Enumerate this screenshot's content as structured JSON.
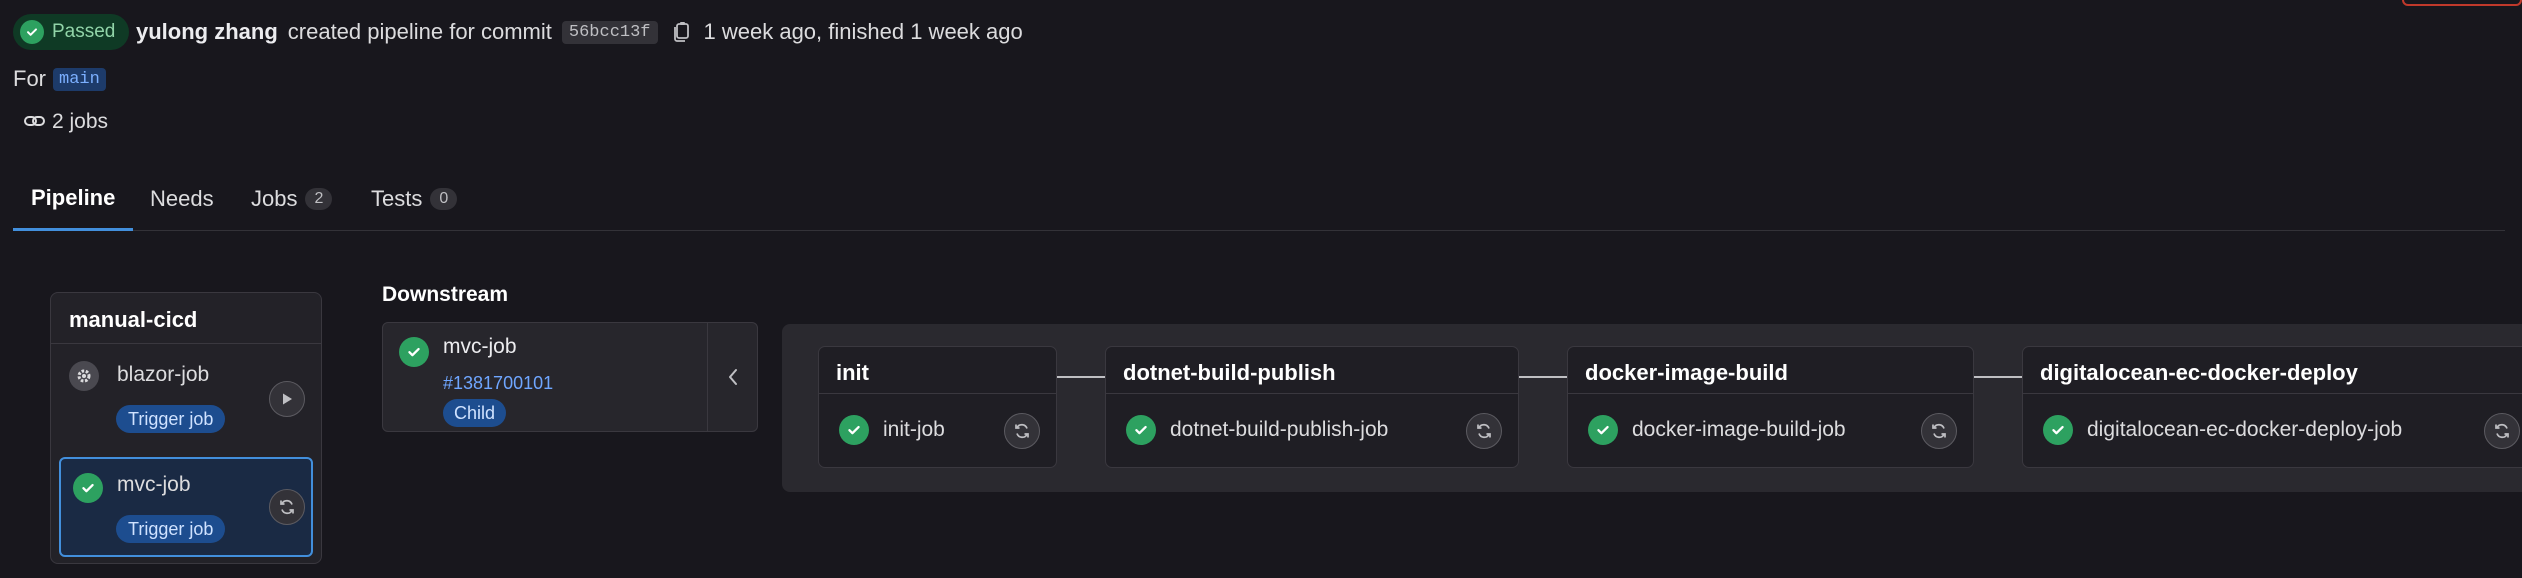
{
  "header": {
    "status": "Passed",
    "author": "yulong zhang",
    "action": "created pipeline for commit",
    "commit": "56bcc13f",
    "time": "1 week ago, finished 1 week ago",
    "for_label": "For",
    "ref": "main",
    "jobs_summary": "2 jobs"
  },
  "tabs": [
    {
      "label": "Pipeline"
    },
    {
      "label": "Needs"
    },
    {
      "label": "Jobs",
      "count": "2"
    },
    {
      "label": "Tests",
      "count": "0"
    }
  ],
  "stage": {
    "title": "manual-cicd",
    "jobs": [
      {
        "name": "blazor-job",
        "badge": "Trigger job"
      },
      {
        "name": "mvc-job",
        "badge": "Trigger job"
      }
    ]
  },
  "downstream": {
    "label": "Downstream",
    "name": "mvc-job",
    "link": "#1381700101",
    "badge": "Child",
    "stages": [
      {
        "title": "init",
        "job": "init-job"
      },
      {
        "title": "dotnet-build-publish",
        "job": "dotnet-build-publish-job"
      },
      {
        "title": "docker-image-build",
        "job": "docker-image-build-job"
      },
      {
        "title": "digitalocean-ec-docker-deploy",
        "job": "digitalocean-ec-docker-deploy-job"
      }
    ]
  },
  "colors": {
    "background": "#18171d",
    "success": "#2da160",
    "accent": "#428fdc",
    "link": "#6fa6ff"
  },
  "icons": [
    "check-circle-icon",
    "copy-icon",
    "link-icon",
    "gear-icon",
    "play-icon",
    "retry-icon",
    "chevron-left-icon"
  ]
}
